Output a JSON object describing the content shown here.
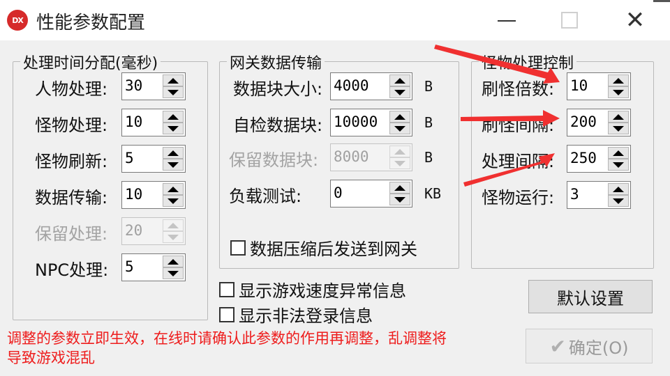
{
  "window": {
    "icon_text": "DX",
    "title": "性能参数配置",
    "close_glyph": "✕"
  },
  "group_time": {
    "title": "处理时间分配(毫秒)",
    "rows": [
      {
        "label": "人物处理:",
        "value": "30"
      },
      {
        "label": "怪物处理:",
        "value": "10"
      },
      {
        "label": "怪物刷新:",
        "value": "5"
      },
      {
        "label": "数据传输:",
        "value": "10"
      },
      {
        "label": "保留处理:",
        "value": "20",
        "disabled": true
      },
      {
        "label": "NPC处理:",
        "value": "5"
      }
    ]
  },
  "group_gateway": {
    "title": "网关数据传输",
    "rows": [
      {
        "label": "数据块大小:",
        "value": "4000",
        "unit": "B"
      },
      {
        "label": "自检数据块:",
        "value": "10000",
        "unit": "B"
      },
      {
        "label": "保留数据块:",
        "value": "8000",
        "unit": "B",
        "disabled": true
      },
      {
        "label": "负载测试:",
        "value": "0",
        "unit": "KB"
      }
    ],
    "compress_checkbox": "数据压缩后发送到网关"
  },
  "group_monster": {
    "title": "怪物处理控制",
    "rows": [
      {
        "label": "刷怪倍数:",
        "value": "10"
      },
      {
        "label": "刷怪间隔:",
        "value": "200"
      },
      {
        "label": "处理间隔:",
        "value": "250"
      },
      {
        "label": "怪物运行:",
        "value": "3"
      }
    ]
  },
  "checkboxes": {
    "speed_anomaly": "显示游戏速度异常信息",
    "illegal_login": "显示非法登录信息"
  },
  "buttons": {
    "default_settings": "默认设置",
    "confirm": "确定(O)"
  },
  "warning_text": "调整的参数立即生效，在线时请确认此参数的作用再调整，乱调整将导致游戏混乱",
  "colors": {
    "warning": "#ee1c1c",
    "annotation_arrow": "#f03030"
  }
}
